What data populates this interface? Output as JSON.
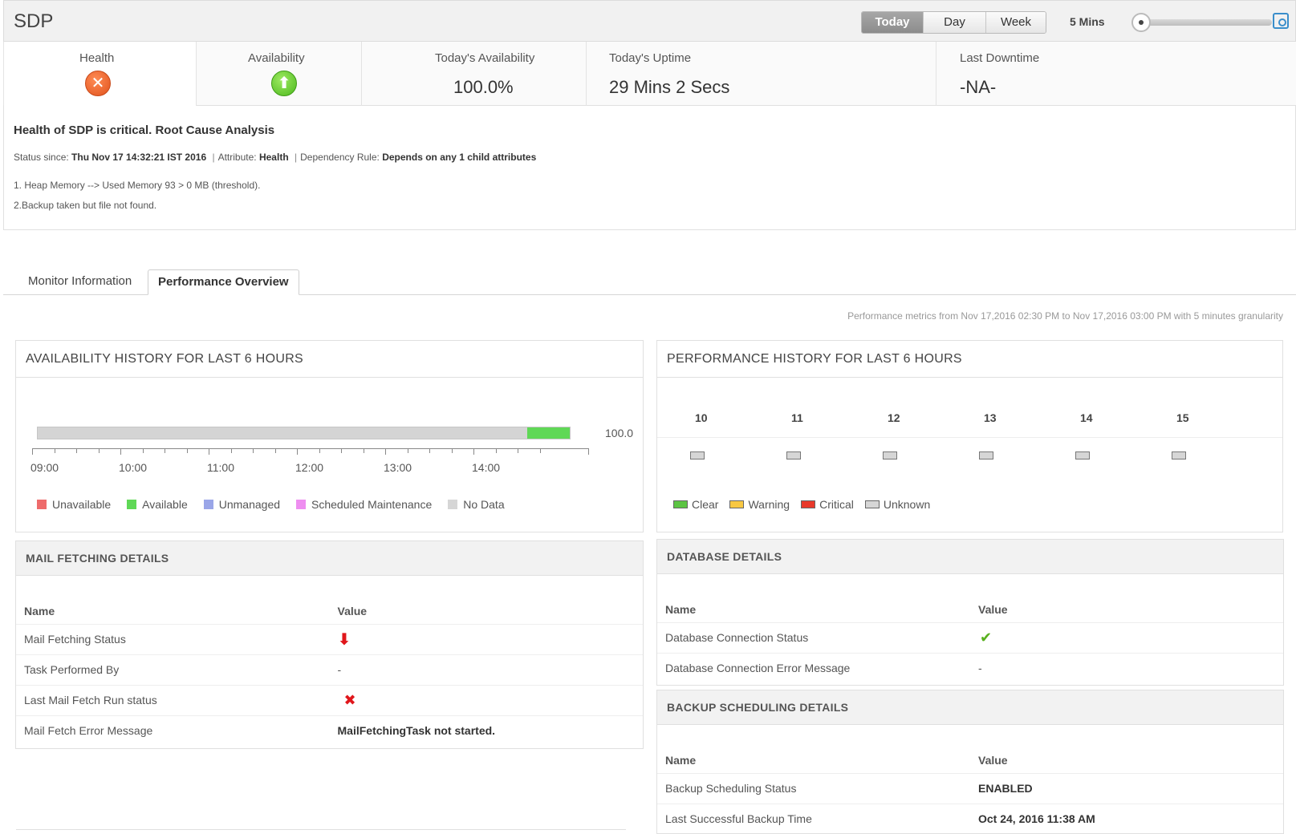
{
  "header": {
    "title": "SDP",
    "range_buttons": [
      "Today",
      "Day",
      "Week"
    ],
    "interval": "5 Mins"
  },
  "summary": {
    "health_label": "Health",
    "availability_label": "Availability",
    "todays_availability_label": "Today's Availability",
    "todays_availability_value": "100.0%",
    "todays_uptime_label": "Today's Uptime",
    "todays_uptime_value": "29 Mins 2 Secs",
    "last_downtime_label": "Last Downtime",
    "last_downtime_value": "-NA-"
  },
  "rca": {
    "title": "Health of SDP is critical. Root Cause Analysis",
    "status_since_label": "Status since:",
    "status_since_value": "Thu Nov 17 14:32:21 IST 2016",
    "attribute_label": "Attribute:",
    "attribute_value": "Health",
    "dependency_label": "Dependency Rule:",
    "dependency_value": "Depends on any 1 child attributes",
    "lines": [
      "1. Heap Memory --> Used Memory 93 > 0 MB (threshold).",
      "2.Backup taken but file not found."
    ]
  },
  "tabs": [
    "Monitor Information",
    "Performance Overview"
  ],
  "metrics_note": "Performance metrics from Nov 17,2016 02:30 PM to Nov 17,2016 03:00 PM with 5 minutes granularity",
  "availability": {
    "title": "AVAILABILITY HISTORY FOR LAST 6 HOURS",
    "value_label": "100.0",
    "available_fraction": 0.08,
    "ticks": [
      "09:00",
      "10:00",
      "11:00",
      "12:00",
      "13:00",
      "14:00"
    ],
    "legend": [
      {
        "label": "Unavailable",
        "color": "#ee6b6b"
      },
      {
        "label": "Available",
        "color": "#5fd856"
      },
      {
        "label": "Unmanaged",
        "color": "#9aa6e8"
      },
      {
        "label": "Scheduled Maintenance",
        "color": "#ee8ef0"
      },
      {
        "label": "No Data",
        "color": "#d6d6d6"
      }
    ]
  },
  "performance": {
    "title": "PERFORMANCE HISTORY FOR LAST 6 HOURS",
    "hours": [
      "10",
      "11",
      "12",
      "13",
      "14",
      "15"
    ],
    "legend": [
      {
        "label": "Clear",
        "color": "#5cc443"
      },
      {
        "label": "Warning",
        "color": "#f8c843"
      },
      {
        "label": "Critical",
        "color": "#e8392b"
      },
      {
        "label": "Unknown",
        "color": "#d6d6d6"
      }
    ]
  },
  "mail_fetching": {
    "title": "MAIL FETCHING DETAILS",
    "col_name": "Name",
    "col_value": "Value",
    "rows": [
      {
        "name": "Mail Fetching Status",
        "value_icon": "down-arrow-icon"
      },
      {
        "name": "Task Performed By",
        "value": "-"
      },
      {
        "name": "Last Mail Fetch Run status",
        "value_icon": "x-mark-icon"
      },
      {
        "name": "Mail Fetch Error Message",
        "value": "MailFetchingTask not started."
      }
    ]
  },
  "database": {
    "title": "DATABASE DETAILS",
    "col_name": "Name",
    "col_value": "Value",
    "rows": [
      {
        "name": "Database Connection Status",
        "value_icon": "check-mark-icon"
      },
      {
        "name": "Database Connection Error Message",
        "value": "-"
      }
    ]
  },
  "backup": {
    "title": "BACKUP SCHEDULING DETAILS",
    "col_name": "Name",
    "col_value": "Value",
    "rows": [
      {
        "name": "Backup Scheduling Status",
        "value": "ENABLED"
      },
      {
        "name": "Last Successful Backup Time",
        "value": "Oct 24, 2016 11:38 AM"
      }
    ]
  }
}
